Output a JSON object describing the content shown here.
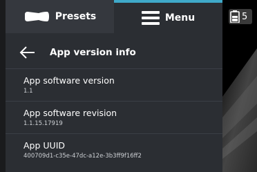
{
  "tabs": {
    "presets_label": "Presets",
    "menu_label": "Menu"
  },
  "icons": {
    "presets": "probe-icon",
    "menu": "hamburger-icon",
    "back": "back-arrow-icon",
    "battery": "battery-icon"
  },
  "colors": {
    "panel": "#2b2e33",
    "active_tab_indicator": "#3fa9c9",
    "divider": "#3b3f46"
  },
  "header": {
    "title": "App version info"
  },
  "info_items": [
    {
      "label": "App software version",
      "value": "1.1"
    },
    {
      "label": "App software revision",
      "value": "1.1.15.17919"
    },
    {
      "label": "App UUID",
      "value": "400709d1-c35e-47dc-a12e-3b3ff9f16ff2"
    }
  ],
  "status": {
    "battery_level": "5"
  }
}
